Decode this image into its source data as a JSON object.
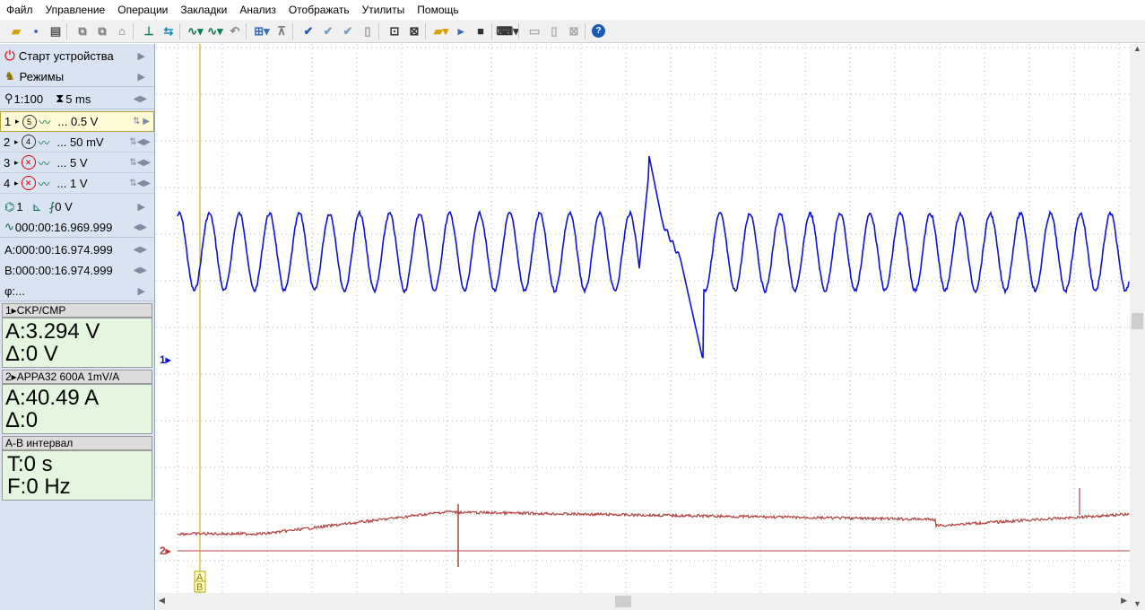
{
  "menu": [
    "Файл",
    "Управление",
    "Операции",
    "Закладки",
    "Анализ",
    "Отображать",
    "Утилиты",
    "Помощь"
  ],
  "sidebar": {
    "start": "Старт устройства",
    "modes": "Режимы",
    "zoom": "1:100",
    "timebase": "5 ms",
    "channels": [
      {
        "num": "1",
        "probe": "5",
        "value": "... 0.5 V",
        "selected": true
      },
      {
        "num": "2",
        "probe": "4",
        "value": "... 50 mV",
        "selected": false
      },
      {
        "num": "3",
        "probe": "x",
        "value": "... 5 V",
        "selected": false
      },
      {
        "num": "4",
        "probe": "x",
        "value": "... 1 V",
        "selected": false
      }
    ],
    "trigger_channel": "1",
    "trigger_level": "0 V",
    "trigger_time": "000:00:16.969.999",
    "cursor_a": "A:000:00:16.974.999",
    "cursor_b": "B:000:00:16.974.999",
    "phi": "φ:..."
  },
  "panels": [
    {
      "title": "1▸CKP/CMP",
      "line1": "A:3.294 V",
      "line2": "Δ:0 V"
    },
    {
      "title": "2▸APPA32 600A 1mV/A",
      "line1": "A:40.49 A",
      "line2": "Δ:0"
    },
    {
      "title": "A-B интервал",
      "line1": "T:0 s",
      "line2": "F:0 Hz"
    }
  ],
  "plot": {
    "ch1_marker": "1▸",
    "ch2_marker": "2▸",
    "cursor_label_a": "A",
    "cursor_label_b": "B",
    "ch1_color": "#1010d0",
    "ch2_color": "#b04040",
    "cursor_color": "#b8a800"
  }
}
